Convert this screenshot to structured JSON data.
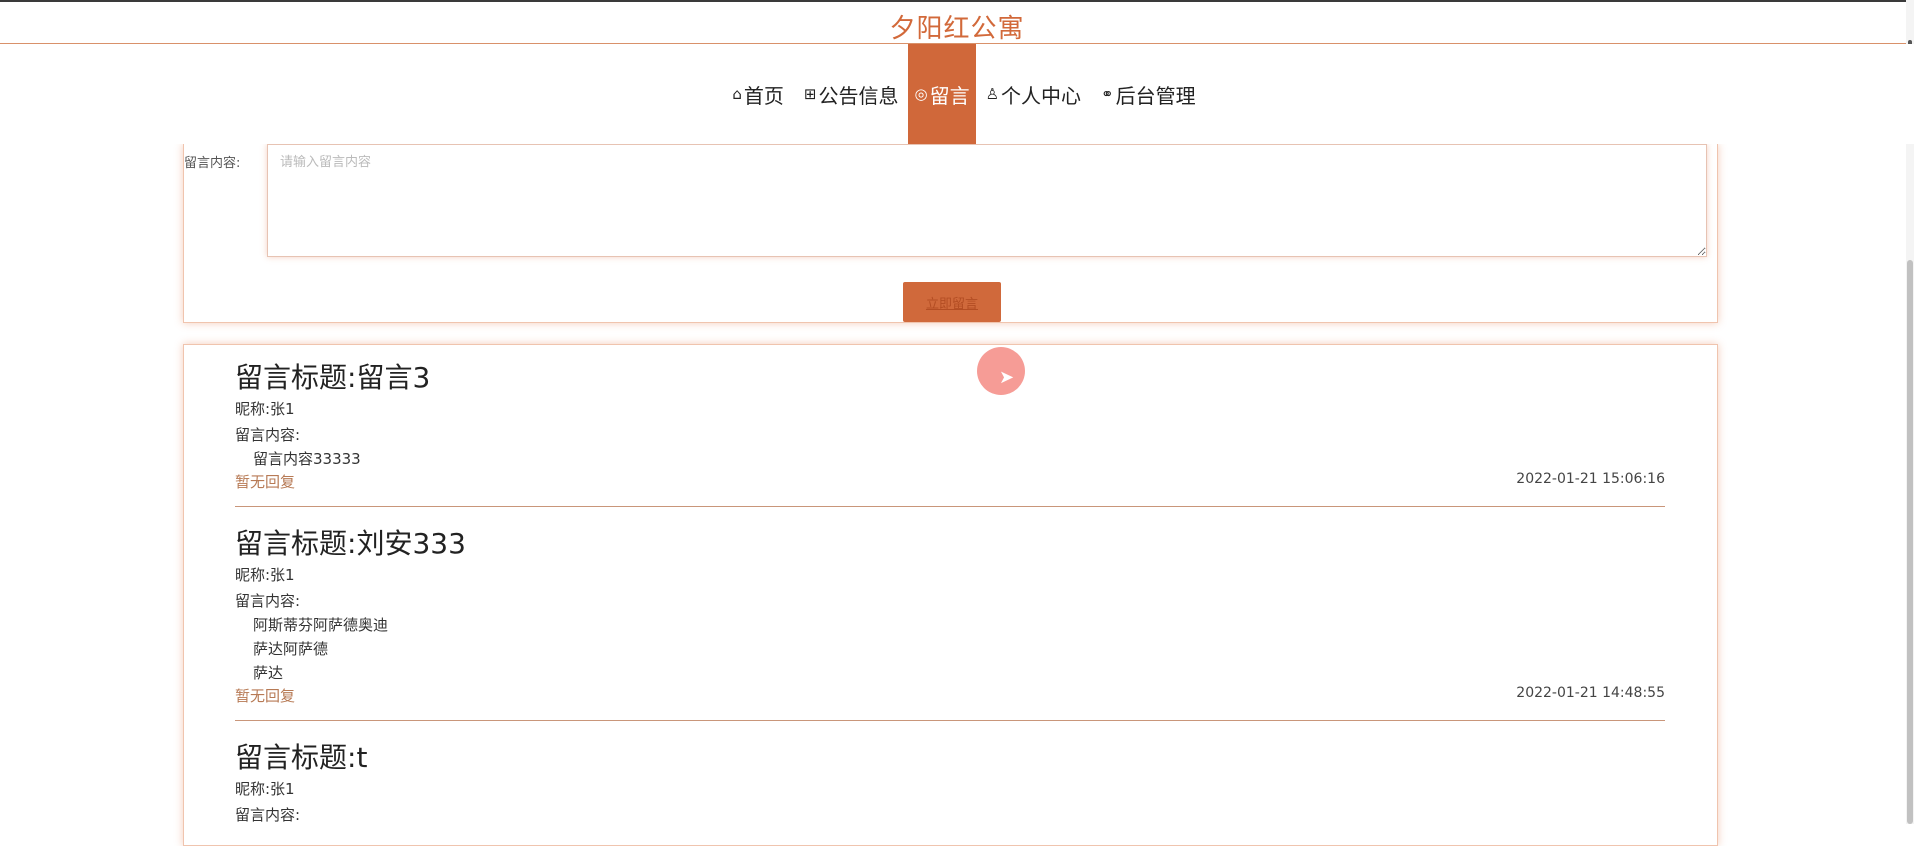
{
  "site": {
    "title": "夕阳红公寓"
  },
  "nav": {
    "items": [
      {
        "icon": "home-icon",
        "glyph": "⌂",
        "label": "首页",
        "active": false
      },
      {
        "icon": "grid-icon",
        "glyph": "⊞",
        "label": "公告信息",
        "active": false
      },
      {
        "icon": "chat-icon",
        "glyph": "◎",
        "label": "留言",
        "active": true
      },
      {
        "icon": "user-icon",
        "glyph": "♙",
        "label": "个人中心",
        "active": false
      },
      {
        "icon": "link-icon",
        "glyph": "⚭",
        "label": "后台管理",
        "active": false
      }
    ]
  },
  "form": {
    "content_label": "留言内容:",
    "content_placeholder": "请输入留言内容",
    "submit_label": "立即留言"
  },
  "messages": [
    {
      "title_prefix": "留言标题:",
      "title": "留言3",
      "nickname_line": "昵称:张1",
      "content_label": "留言内容:",
      "content_lines": [
        "留言内容33333"
      ],
      "reply": "暂无回复",
      "time": "2022-01-21 15:06:16"
    },
    {
      "title_prefix": "留言标题:",
      "title": "刘安333",
      "nickname_line": "昵称:张1",
      "content_label": "留言内容:",
      "content_lines": [
        "阿斯蒂芬阿萨德奥迪",
        "萨达阿萨德",
        "萨达"
      ],
      "reply": "暂无回复",
      "time": "2022-01-21 14:48:55"
    },
    {
      "title_prefix": "留言标题:",
      "title": "t",
      "nickname_line": "昵称:张1",
      "content_label": "留言内容:",
      "content_lines": [],
      "reply": "",
      "time": ""
    }
  ],
  "colors": {
    "accent": "#d0683a",
    "title": "#d2693a",
    "reply": "#b77a55"
  }
}
